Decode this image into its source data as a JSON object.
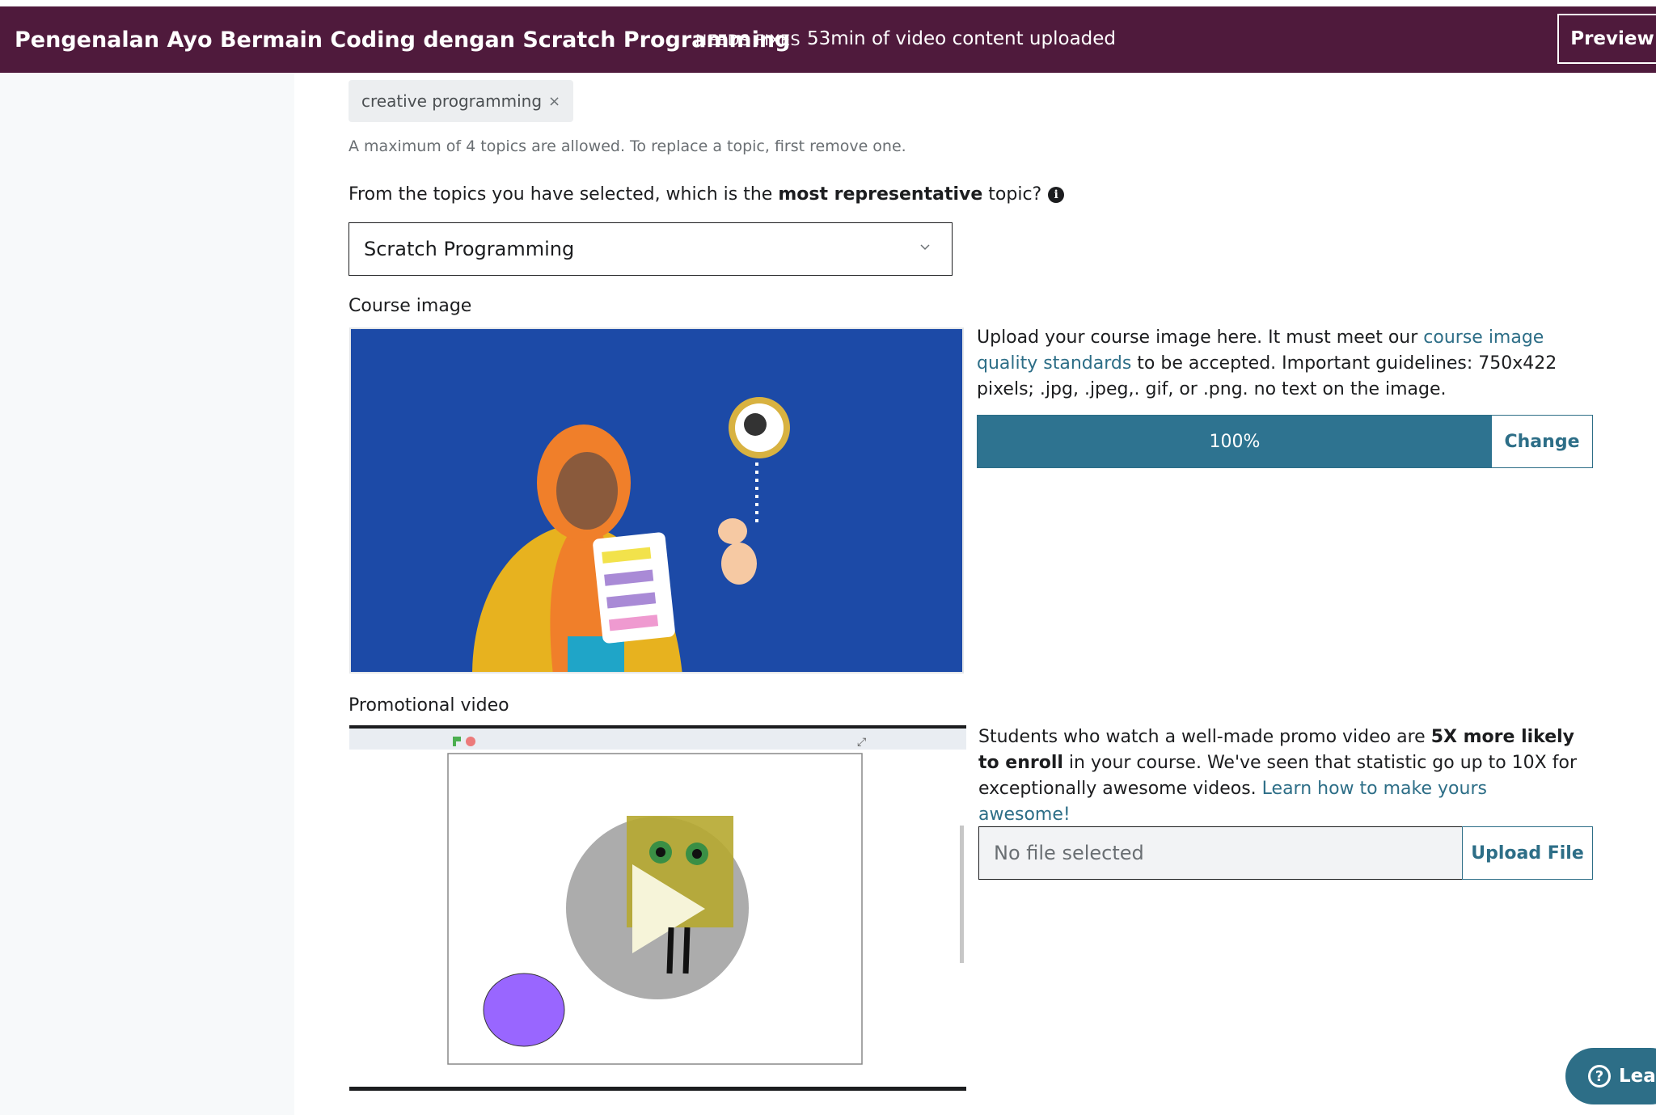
{
  "header": {
    "course_title": "Pengenalan Ayo Bermain Coding dengan Scratch Programming",
    "status_badge": "NEEDS FIXES",
    "upload_status": "53min of video content uploaded",
    "preview_label": "Preview"
  },
  "topics": {
    "selected_topic": "creative programming",
    "remove_symbol": "×",
    "hint": "A maximum of 4 topics are allowed. To replace a topic, first remove one.",
    "question_before": "From the topics you have selected, which is the ",
    "question_bold": "most representative",
    "question_after": " topic?",
    "info_symbol": "i",
    "representative_value": "Scratch Programming"
  },
  "course_image": {
    "label": "Course image",
    "desc_before": "Upload your course image here. It must meet our ",
    "desc_link": "course image quality standards",
    "desc_after": " to be accepted. Important guidelines: 750x422 pixels; .jpg, .jpeg,. gif, or .png. no text on the image.",
    "progress": 1.0,
    "progress_label": "100%",
    "change_label": "Change",
    "image_background": "#1c4aa7"
  },
  "promo_video": {
    "label": "Promotional video",
    "desc_before": "Students who watch a well-made promo video are ",
    "desc_bold": "5X more likely to enroll",
    "desc_after": " in your course. We've seen that statistic go up to 10X for exceptionally awesome videos. ",
    "desc_link": "Learn how to make yours awesome!",
    "file_value": "No file selected",
    "upload_label": "Upload File"
  },
  "help": {
    "label": "Lea",
    "icon_symbol": "?"
  },
  "colors": {
    "header_bg": "#4f1a3c",
    "accent": "#2d6e87",
    "progress_fill": "#2e7390"
  }
}
